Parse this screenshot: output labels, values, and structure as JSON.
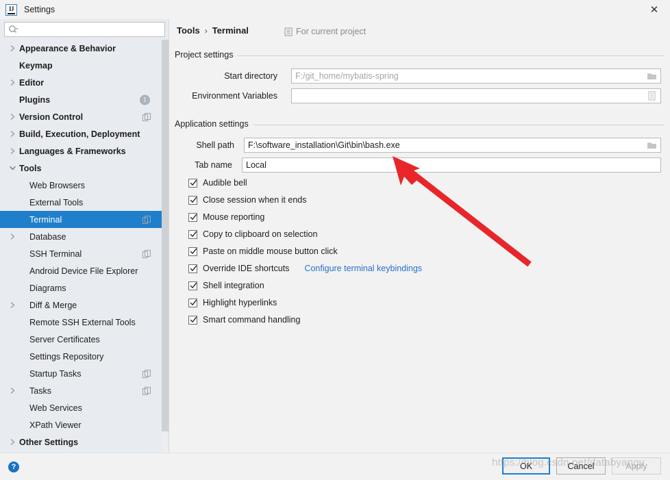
{
  "window": {
    "title": "Settings",
    "app_icon": "intellij-idea-icon",
    "close_label": "✕"
  },
  "search": {
    "value": "",
    "placeholder": "",
    "icon": "search-icon"
  },
  "sidebar": {
    "items": [
      {
        "label": "Appearance & Behavior",
        "indent": 0,
        "bold": true,
        "arrow": "collapsed",
        "selected": false,
        "badge": null,
        "copy_icon": false
      },
      {
        "label": "Keymap",
        "indent": 0,
        "bold": true,
        "arrow": "none",
        "selected": false,
        "badge": null,
        "copy_icon": false
      },
      {
        "label": "Editor",
        "indent": 0,
        "bold": true,
        "arrow": "collapsed",
        "selected": false,
        "badge": null,
        "copy_icon": false
      },
      {
        "label": "Plugins",
        "indent": 0,
        "bold": true,
        "arrow": "none",
        "selected": false,
        "badge": "1",
        "copy_icon": false
      },
      {
        "label": "Version Control",
        "indent": 0,
        "bold": true,
        "arrow": "collapsed",
        "selected": false,
        "badge": null,
        "copy_icon": true
      },
      {
        "label": "Build, Execution, Deployment",
        "indent": 0,
        "bold": true,
        "arrow": "collapsed",
        "selected": false,
        "badge": null,
        "copy_icon": false
      },
      {
        "label": "Languages & Frameworks",
        "indent": 0,
        "bold": true,
        "arrow": "collapsed",
        "selected": false,
        "badge": null,
        "copy_icon": false
      },
      {
        "label": "Tools",
        "indent": 0,
        "bold": true,
        "arrow": "expanded",
        "selected": false,
        "badge": null,
        "copy_icon": false
      },
      {
        "label": "Web Browsers",
        "indent": 1,
        "bold": false,
        "arrow": "none",
        "selected": false,
        "badge": null,
        "copy_icon": false
      },
      {
        "label": "External Tools",
        "indent": 1,
        "bold": false,
        "arrow": "none",
        "selected": false,
        "badge": null,
        "copy_icon": false
      },
      {
        "label": "Terminal",
        "indent": 1,
        "bold": false,
        "arrow": "none",
        "selected": true,
        "badge": null,
        "copy_icon": true
      },
      {
        "label": "Database",
        "indent": 1,
        "bold": false,
        "arrow": "collapsed",
        "selected": false,
        "badge": null,
        "copy_icon": false
      },
      {
        "label": "SSH Terminal",
        "indent": 1,
        "bold": false,
        "arrow": "none",
        "selected": false,
        "badge": null,
        "copy_icon": true
      },
      {
        "label": "Android Device File Explorer",
        "indent": 1,
        "bold": false,
        "arrow": "none",
        "selected": false,
        "badge": null,
        "copy_icon": false
      },
      {
        "label": "Diagrams",
        "indent": 1,
        "bold": false,
        "arrow": "none",
        "selected": false,
        "badge": null,
        "copy_icon": false
      },
      {
        "label": "Diff & Merge",
        "indent": 1,
        "bold": false,
        "arrow": "collapsed",
        "selected": false,
        "badge": null,
        "copy_icon": false
      },
      {
        "label": "Remote SSH External Tools",
        "indent": 1,
        "bold": false,
        "arrow": "none",
        "selected": false,
        "badge": null,
        "copy_icon": false
      },
      {
        "label": "Server Certificates",
        "indent": 1,
        "bold": false,
        "arrow": "none",
        "selected": false,
        "badge": null,
        "copy_icon": false
      },
      {
        "label": "Settings Repository",
        "indent": 1,
        "bold": false,
        "arrow": "none",
        "selected": false,
        "badge": null,
        "copy_icon": false
      },
      {
        "label": "Startup Tasks",
        "indent": 1,
        "bold": false,
        "arrow": "none",
        "selected": false,
        "badge": null,
        "copy_icon": true
      },
      {
        "label": "Tasks",
        "indent": 1,
        "bold": false,
        "arrow": "collapsed",
        "selected": false,
        "badge": null,
        "copy_icon": true
      },
      {
        "label": "Web Services",
        "indent": 1,
        "bold": false,
        "arrow": "none",
        "selected": false,
        "badge": null,
        "copy_icon": false
      },
      {
        "label": "XPath Viewer",
        "indent": 1,
        "bold": false,
        "arrow": "none",
        "selected": false,
        "badge": null,
        "copy_icon": false
      },
      {
        "label": "Other Settings",
        "indent": 0,
        "bold": true,
        "arrow": "collapsed",
        "selected": false,
        "badge": null,
        "copy_icon": false
      }
    ]
  },
  "main": {
    "breadcrumb": {
      "parent": "Tools",
      "separator": "›",
      "current": "Terminal"
    },
    "scope_note": {
      "icon": "module-icon",
      "text": "For current project"
    },
    "project_settings": {
      "title": "Project settings",
      "fields": [
        {
          "label": "Start directory",
          "value": "F:/git_home/mybatis-spring",
          "is_placeholder": true,
          "trailing_icon": "folder-icon"
        },
        {
          "label": "Environment Variables",
          "value": "",
          "is_placeholder": false,
          "trailing_icon": "list-icon"
        }
      ]
    },
    "application_settings": {
      "title": "Application settings",
      "fields": [
        {
          "label": "Shell path",
          "value": "F:\\software_installation\\Git\\bin\\bash.exe",
          "is_placeholder": false,
          "trailing_icon": "folder-icon"
        },
        {
          "label": "Tab name",
          "value": "Local",
          "is_placeholder": false,
          "trailing_icon": null
        }
      ],
      "checkboxes": [
        {
          "label": "Audible bell",
          "checked": true,
          "link": null
        },
        {
          "label": "Close session when it ends",
          "checked": true,
          "link": null
        },
        {
          "label": "Mouse reporting",
          "checked": true,
          "link": null
        },
        {
          "label": "Copy to clipboard on selection",
          "checked": true,
          "link": null
        },
        {
          "label": "Paste on middle mouse button click",
          "checked": true,
          "link": null
        },
        {
          "label": "Override IDE shortcuts",
          "checked": true,
          "link": "Configure terminal keybindings"
        },
        {
          "label": "Shell integration",
          "checked": true,
          "link": null
        },
        {
          "label": "Highlight hyperlinks",
          "checked": true,
          "link": null
        },
        {
          "label": "Smart command handling",
          "checked": true,
          "link": null
        }
      ]
    }
  },
  "footer": {
    "help_label": "?",
    "buttons": [
      {
        "label": "OK",
        "style": "default"
      },
      {
        "label": "Cancel",
        "style": "normal"
      },
      {
        "label": "Apply",
        "style": "disabled"
      }
    ]
  },
  "annotation": {
    "arrow_color": "#e8262a"
  },
  "watermark": {
    "text": "https://blog.csdn.net/databyangu"
  },
  "colors": {
    "selection_blue": "#1f7fcb",
    "link_blue": "#2a6fc9",
    "sidebar_bg": "#e8ebef",
    "panel_bg": "#f2f2f2"
  }
}
